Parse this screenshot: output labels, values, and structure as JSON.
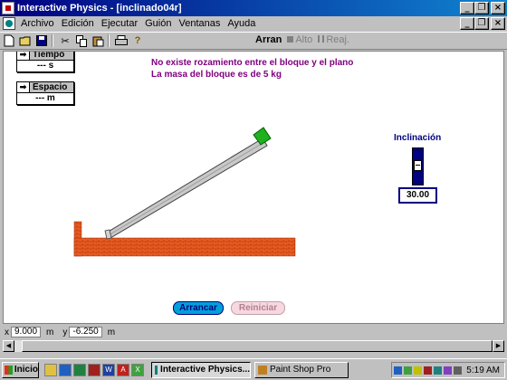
{
  "window": {
    "title": "Interactive Physics - [inclinado04r]"
  },
  "menu": [
    "Archivo",
    "Edición",
    "Ejecutar",
    "Guión",
    "Ventanas",
    "Ayuda"
  ],
  "toolbar": {
    "run_label": "Arran",
    "stop_label": "Alto",
    "reset_label": "Reaj."
  },
  "meters": {
    "tiempo": {
      "label": "Tiempo",
      "value": "--- s"
    },
    "espacio": {
      "label": "Espacio",
      "value": "--- m"
    }
  },
  "info": {
    "line1": "No existe rozamiento entre el bloque y el plano",
    "line2": "La masa del bloque es de 5 kg"
  },
  "inclination": {
    "label": "Inclinación",
    "value": "30.00",
    "slider_level": 0.45
  },
  "buttons": {
    "arrancar": "Arrancar",
    "reiniciar": "Reiniciar"
  },
  "coords": {
    "x_prefix": "x",
    "x_value": "9.000",
    "x_unit": "m",
    "y_prefix": "y",
    "y_value": "-6.250",
    "y_unit": "m"
  },
  "taskbar": {
    "start": "Inicio",
    "tasks": [
      "Interactive Physics...",
      "Paint Shop Pro"
    ],
    "clock": "5:19 AM"
  },
  "colors": {
    "ground": "#e06020",
    "block": "#20b020",
    "ramp": "#c0c0c0",
    "info_text": "#800080",
    "accent": "#000080"
  }
}
